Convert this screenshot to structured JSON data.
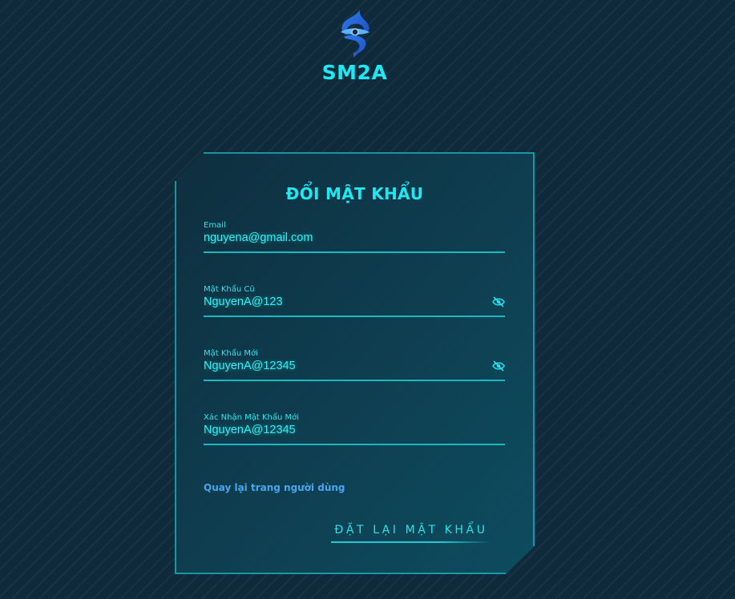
{
  "brand": {
    "logo_icon": "sm2a-logo-icon",
    "name": "SM2A"
  },
  "form": {
    "title": "ĐỔI MẬT KHẨU",
    "fields": [
      {
        "label": "Email",
        "value": "nguyena@gmail.com",
        "has_toggle": false
      },
      {
        "label": "Mật Khẩu Cũ",
        "value": "NguyenA@123",
        "has_toggle": true,
        "toggle_icon": "eye-slash-icon"
      },
      {
        "label": "Mật Khẩu Mới",
        "value": "NguyenA@12345",
        "has_toggle": true,
        "toggle_icon": "eye-slash-icon"
      },
      {
        "label": "Xác Nhận Mật Khẩu Mới",
        "value": "NguyenA@12345",
        "has_toggle": false
      }
    ],
    "back_link": "Quay lại trang người dùng",
    "submit_label": "ĐẶT LẠI MẬT KHẨU"
  },
  "colors": {
    "accent": "#1de9f2",
    "link": "#4aa6f0",
    "background": "#0f2a3a"
  }
}
